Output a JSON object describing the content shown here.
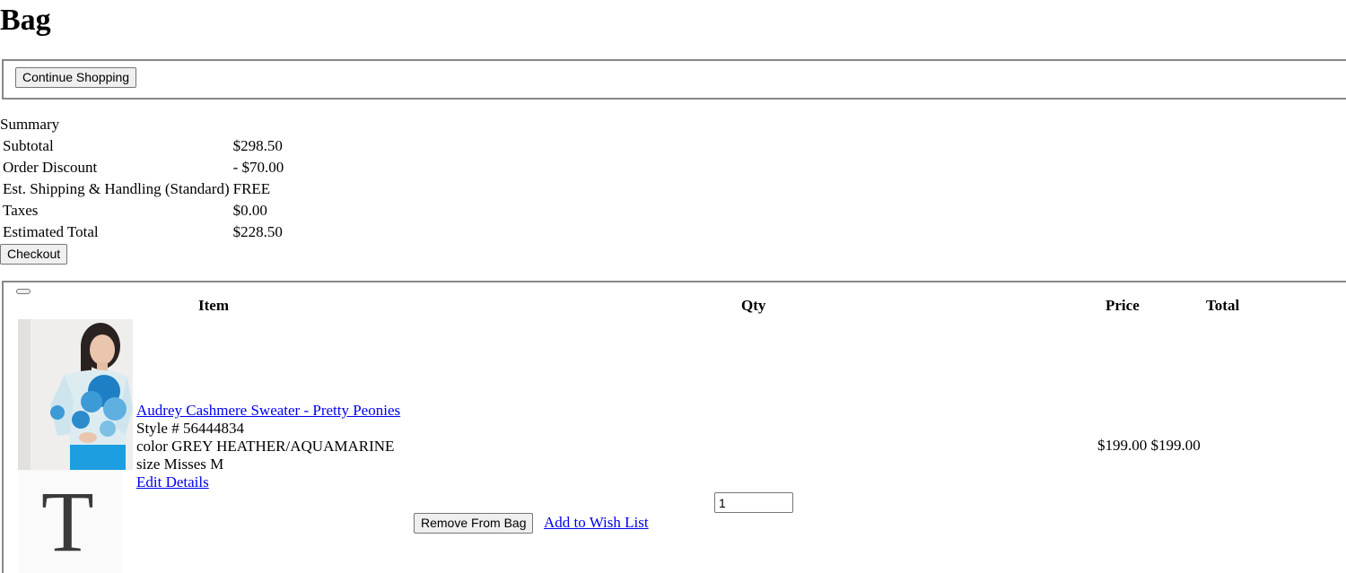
{
  "page": {
    "title": "Bag"
  },
  "toolbar": {
    "continue_label": "Continue Shopping"
  },
  "summary": {
    "caption": "Summary",
    "rows": [
      {
        "label": "Subtotal",
        "value": "$298.50"
      },
      {
        "label": "Order Discount",
        "value": "- $70.00"
      },
      {
        "label": "Est. Shipping & Handling (Standard)",
        "value": "FREE"
      },
      {
        "label": "Taxes",
        "value": "$0.00"
      },
      {
        "label": "Estimated Total",
        "value": "$228.50"
      }
    ],
    "checkout_label": "Checkout"
  },
  "bag": {
    "headers": {
      "item": "Item",
      "qty": "Qty",
      "price": "Price",
      "total": "Total"
    },
    "items": [
      {
        "name": "Audrey Cashmere Sweater - Pretty Peonies",
        "style": "Style # 56444834",
        "color": "color GREY HEATHER/AQUAMARINE",
        "size": "size Misses M",
        "edit_label": "Edit Details",
        "price": "$199.00",
        "total": "$199.00",
        "qty": "1",
        "remove_label": "Remove From Bag",
        "wishlist_label": "Add to Wish List",
        "image_icon": "product-photo",
        "promo_letter": "T"
      }
    ]
  },
  "colors": {
    "link": "#0000ee",
    "border": "#888888",
    "accent": "#1e9bd7"
  }
}
